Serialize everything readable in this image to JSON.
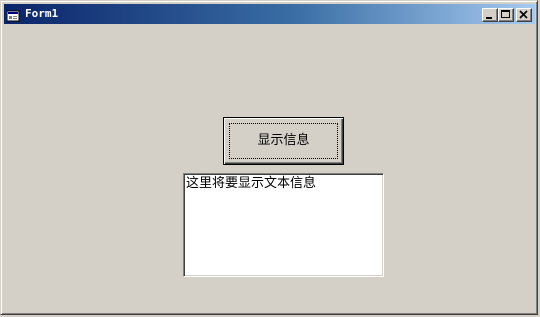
{
  "window": {
    "title": "Form1",
    "titlebar_color_start": "#0a246a",
    "titlebar_color_end": "#a6caf0",
    "background": "#d4d0c8",
    "controls": {
      "minimize_icon": "minimize-icon",
      "maximize_icon": "maximize-icon",
      "close_icon": "close-icon"
    }
  },
  "form": {
    "button_label": "显示信息",
    "textbox_value": "这里将要显示文本信息"
  }
}
